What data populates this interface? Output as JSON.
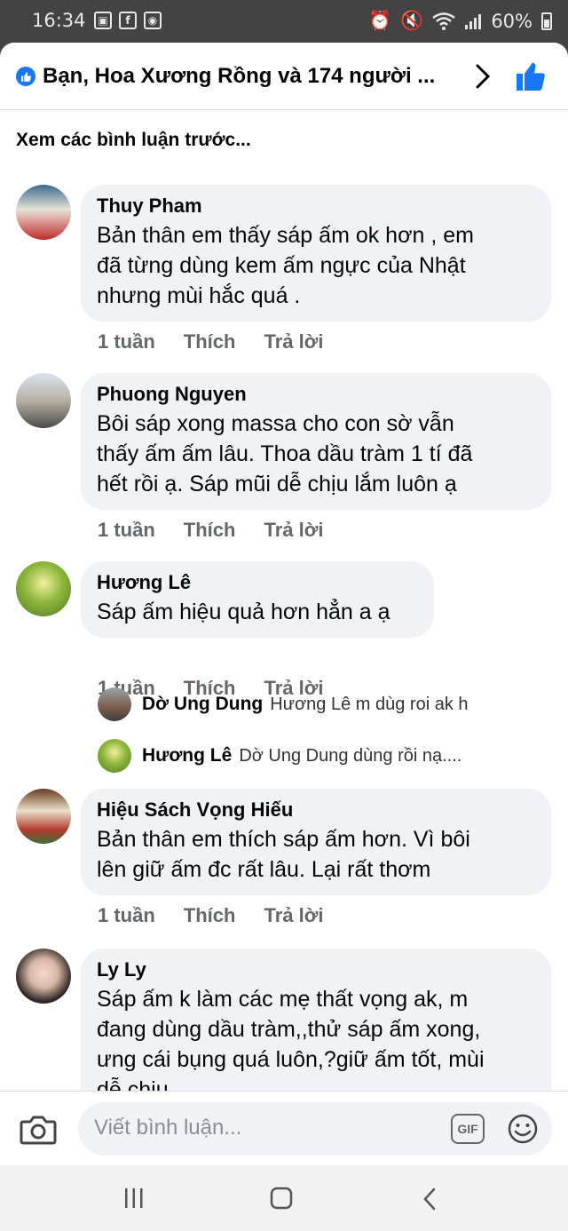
{
  "status_bar": {
    "time": "16:34",
    "battery": "60%"
  },
  "header": {
    "title": "Bạn, Hoa Xương Rồng và 174 người ..."
  },
  "see_previous": "Xem các bình luận trước...",
  "actions": {
    "time": "1 tuần",
    "like": "Thích",
    "reply": "Trả lời"
  },
  "comments": [
    {
      "name": "Thuy Pham",
      "lines": [
        "Bản thân em thấy sáp ấm ok hơn , em",
        "đã từng dùng kem ấm ngực của Nhật",
        "nhưng mùi hắc quá ."
      ]
    },
    {
      "name": "Phuong Nguyen",
      "lines": [
        "Bôi sáp xong massa cho con sờ vẫn",
        "thấy ấm ấm lâu. Thoa dầu tràm 1 tí đã",
        "hết rồi ạ. Sáp mũi dễ chịu lắm luôn ạ"
      ]
    },
    {
      "name": "Hương Lê",
      "lines": [
        "Sáp ấm hiệu quả hơn hẳn a ạ"
      ]
    },
    {
      "name": "Hiệu Sách Vọng Hiếu",
      "lines": [
        "Bản thân em thích sáp ấm hơn. Vì bôi",
        "lên giữ ấm đc rất lâu. Lại rất thơm"
      ]
    },
    {
      "name": "Ly Ly",
      "lines": [
        "Sáp ấm k làm các mẹ thất vọng ak, m",
        "đang dùng dầu tràm,,thử sáp ấm xong,",
        "ưng cái bụng quá luôn,?giữ ấm tốt, mùi",
        "dễ chịu"
      ]
    }
  ],
  "replies": [
    {
      "name": "Dờ Ung Dung",
      "text": "Hương Lê  m dùg roi ak h"
    },
    {
      "name": "Hương Lê",
      "text": "Dờ Ung Dung dùng rồi nạ...."
    }
  ],
  "composer": {
    "placeholder": "Viết bình luận...",
    "gif_label": "GIF"
  }
}
